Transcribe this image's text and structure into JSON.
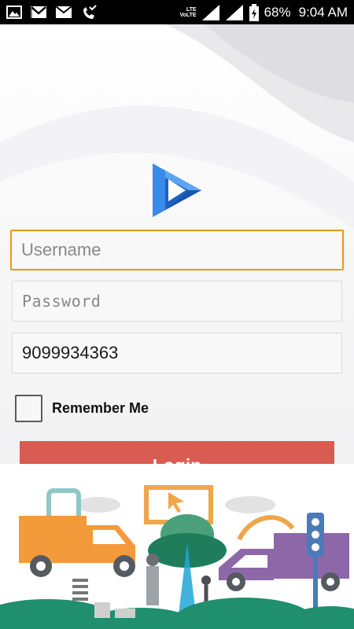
{
  "status_bar": {
    "icons": [
      "gallery-icon",
      "gmail-icon",
      "mail-icon",
      "missed-call-icon"
    ],
    "lte_label": "LTE",
    "volte_label": "VoLTE",
    "battery": "68%",
    "time": "9:04 AM"
  },
  "login": {
    "username_placeholder": "Username",
    "password_placeholder": "Password",
    "phone_value": "9099934363",
    "remember_label": "Remember Me",
    "remember_checked": false,
    "login_label": "Login"
  },
  "colors": {
    "accent_focus": "#f0941c",
    "login_button": "#d95c52",
    "logo_blue": "#2b7de0"
  }
}
